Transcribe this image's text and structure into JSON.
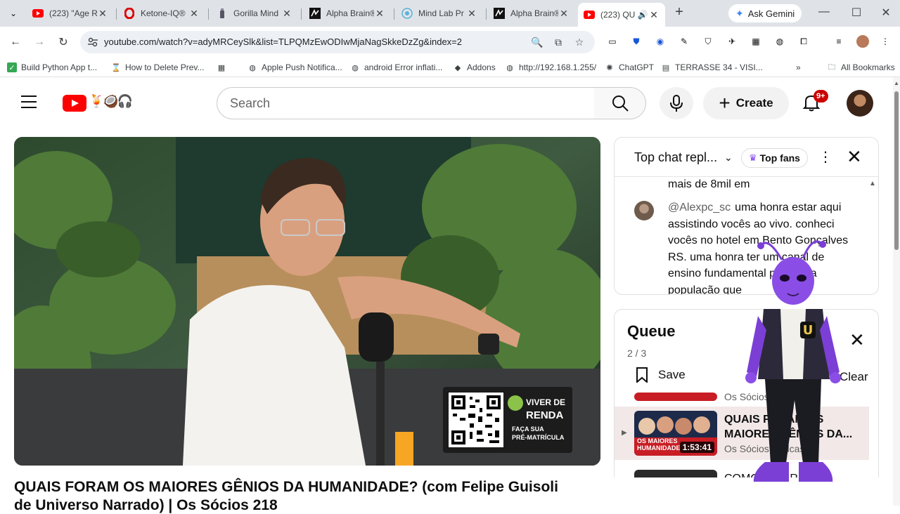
{
  "browser": {
    "tabs": [
      {
        "title": "(223) \"Age R",
        "icon": "youtube-icon"
      },
      {
        "title": "Ketone-IQ®",
        "icon": "opera-icon"
      },
      {
        "title": "Gorilla Mind",
        "icon": "bottle-icon"
      },
      {
        "title": "Alpha Brain®",
        "icon": "onnit-icon"
      },
      {
        "title": "Mind Lab Pr",
        "icon": "mindlab-icon"
      },
      {
        "title": "Alpha Brain®",
        "icon": "onnit-icon"
      },
      {
        "title": "(223) QU",
        "icon": "youtube-icon",
        "active": true
      }
    ],
    "gemini_label": "Ask Gemini",
    "url": "youtube.com/watch?v=adyMRCeySlk&list=TLPQMzEwODIwMjaNagSkkeDzZg&index=2",
    "bookmarks": [
      {
        "label": "Build Python App t...",
        "icon": "checkbox-icon"
      },
      {
        "label": "How to Delete Prev...",
        "icon": "hourglass-icon"
      },
      {
        "label": "",
        "icon": "apps-grid-icon"
      },
      {
        "label": "Apple Push Notifica...",
        "icon": "globe-icon"
      },
      {
        "label": "android Error inflati...",
        "icon": "globe-icon"
      },
      {
        "label": "Addons",
        "icon": "diamond-icon"
      },
      {
        "label": "http://192.168.1.255/",
        "icon": "globe-icon"
      },
      {
        "label": "ChatGPT",
        "icon": "chatgpt-icon"
      },
      {
        "label": "TERRASSE 34 - VISI...",
        "icon": "page-icon"
      }
    ],
    "all_bookmarks_label": "All Bookmarks"
  },
  "youtube": {
    "search_placeholder": "Search",
    "create_label": "Create",
    "notifications_badge": "9+",
    "video": {
      "title_line1": "QUAIS FORAM OS MAIORES GÊNIOS DA HUMANIDADE? (com Felipe Guisoli",
      "title_line2": "de Universo Narrado) | Os Sócios 218",
      "qr_brand": "VIVER DE RENDA",
      "qr_brand_top": "VIVER DE",
      "qr_brand_bottom": "RENDA",
      "qr_cta_line1": "FAÇA SUA",
      "qr_cta_line2": "PRÉ-MATRÍCULA"
    },
    "chat": {
      "title": "Top chat repl...",
      "top_fans_label": "Top fans",
      "partial_message": "mais de 8mil em",
      "message_author": "@Alexpc_sc",
      "message_text": "uma honra estar aqui assistindo vocês ao vivo. conheci vocês no hotel em Bento Gonçalves RS. uma honra ter um canal de ensino fundamental para uma população que"
    },
    "queue": {
      "title": "Queue",
      "position": "2 / 3",
      "save_label": "Save",
      "clear_label": "Clear",
      "items": [
        {
          "title": "",
          "channel": "Os Sócios Podcast"
        },
        {
          "title": "QUAIS FORAM OS MAIORES GÊNIOS DA...",
          "channel": "Os Sócios Podcast",
          "duration": "1:53:41",
          "thumb_text": "OS MAIORES HUMANIDADE",
          "active": true
        },
        {
          "title": "COMO FALAR",
          "channel": ""
        }
      ]
    }
  },
  "colors": {
    "youtube_red": "#ff0000",
    "badge_red": "#cc0000",
    "queue_active_bg": "#f2e8e8",
    "tabstrip_bg": "#dfe3e8"
  }
}
